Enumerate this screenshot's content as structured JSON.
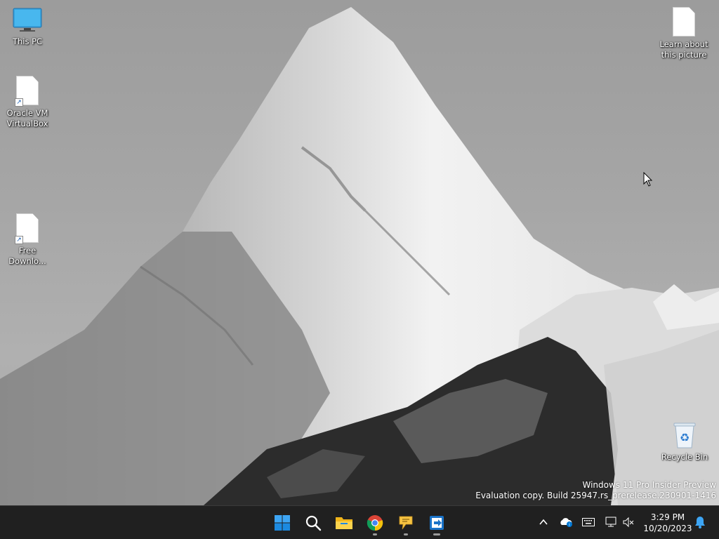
{
  "desktop": {
    "icons": [
      {
        "label": "This PC",
        "icon": "monitor-icon"
      },
      {
        "label": "Oracle VM VirtualBox",
        "icon": "document-shortcut-icon"
      },
      {
        "label": "Free Downlo...",
        "icon": "document-shortcut-icon"
      },
      {
        "label": "Learn about this picture",
        "icon": "document-icon"
      },
      {
        "label": "Recycle Bin",
        "icon": "recycle-bin-icon"
      }
    ],
    "watermark": {
      "line1": "Windows 11 Pro Insider Preview",
      "line2": "Evaluation copy. Build 25947.rs_prerelease.230901-1416"
    }
  },
  "taskbar": {
    "background": "#202020",
    "apps": [
      {
        "name": "Start",
        "icon": "windows-start-icon",
        "running": false
      },
      {
        "name": "Search",
        "icon": "search-icon",
        "running": false
      },
      {
        "name": "File Explorer",
        "icon": "folder-icon",
        "running": false
      },
      {
        "name": "Google Chrome",
        "icon": "chrome-icon",
        "running": true
      },
      {
        "name": "Feedback Hub",
        "icon": "feedback-icon",
        "running": true
      },
      {
        "name": "Remote app",
        "icon": "remote-app-icon",
        "running": true
      }
    ],
    "tray": {
      "icons": [
        "chevron-up-icon",
        "onedrive-icon",
        "keyboard-icon",
        "network-icon",
        "speaker-muted-icon",
        "notification-bell-icon"
      ],
      "time": "3:29 PM",
      "date": "10/20/2023"
    },
    "accent": "#0078d4"
  }
}
